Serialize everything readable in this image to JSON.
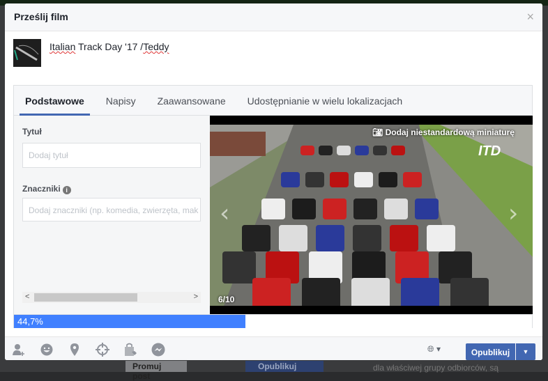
{
  "background": {
    "promote_label": "Promuj post",
    "publish_label": "Opublikuj",
    "text": "dla właściwej grupy odbiorców, są"
  },
  "dialog": {
    "title": "Prześlij film",
    "close": "×"
  },
  "video": {
    "title_part1": "Italian",
    "title_part2": " Track Day '17 /",
    "title_part3": "Teddy"
  },
  "tabs": [
    {
      "label": "Podstawowe",
      "active": true
    },
    {
      "label": "Napisy"
    },
    {
      "label": "Zaawansowane"
    },
    {
      "label": "Udostępnianie w wielu lokalizacjach"
    }
  ],
  "form": {
    "title_label": "Tytuł",
    "title_placeholder": "Dodaj tytuł",
    "tags_label": "Znaczniki",
    "tags_placeholder": "Dodaj znaczniki (np. komedia, zwierzęta, mak",
    "info": "i"
  },
  "preview": {
    "custom_thumbnail": "Dodaj niestandardową miniaturę",
    "counter": "6/10",
    "logo": "ITD",
    "prev": "‹",
    "next": "›"
  },
  "upload": {
    "progress_label": "44,7%",
    "progress_percent": 44.7,
    "color": "#4080ff"
  },
  "footer": {
    "icons": [
      "tag-friends-icon",
      "feeling-icon",
      "location-icon",
      "target-icon",
      "shopping-bag-icon",
      "messenger-icon"
    ],
    "publish_label": "Opublikuj",
    "dropdown": "▼",
    "audience_caret": "▾"
  },
  "colors": {
    "brand": "#4267b2"
  }
}
